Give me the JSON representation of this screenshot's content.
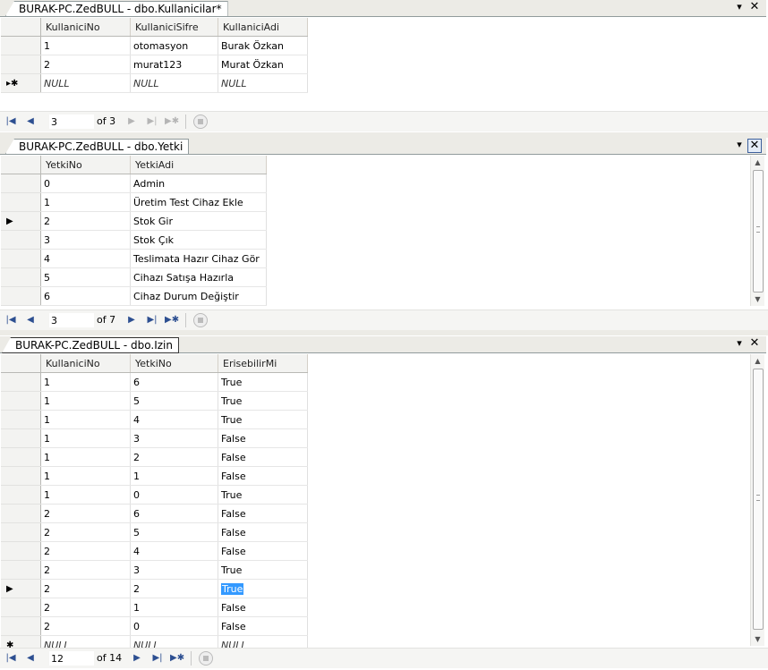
{
  "panes": [
    {
      "tab_title": "BURAK-PC.ZedBULL - dbo.Kullanicilar*",
      "columns": [
        "KullaniciNo",
        "KullaniciSifre",
        "KullaniciAdi"
      ],
      "rows": [
        [
          "1",
          "otomasyon",
          "Burak Özkan"
        ],
        [
          "2",
          "murat123",
          "Murat Özkan"
        ]
      ],
      "new_row": [
        "NULL",
        "NULL",
        "NULL"
      ],
      "new_row_marker": "▸✱",
      "nav": {
        "position": "3",
        "of_label": "of 3"
      }
    },
    {
      "tab_title": "BURAK-PC.ZedBULL - dbo.Yetki",
      "columns": [
        "YetkiNo",
        "YetkiAdi"
      ],
      "rows": [
        [
          "0",
          "Admin"
        ],
        [
          "1",
          "Üretim Test Cihaz Ekle"
        ],
        [
          "2",
          "Stok Gir"
        ],
        [
          "3",
          "Stok Çık"
        ],
        [
          "4",
          "Teslimata Hazır Cihaz Gör"
        ],
        [
          "5",
          "Cihazı Satışa Hazırla"
        ],
        [
          "6",
          "Cihaz Durum Değiştir"
        ]
      ],
      "current_row_index": 2,
      "nav": {
        "position": "3",
        "of_label": "of 7"
      }
    },
    {
      "tab_title": "BURAK-PC.ZedBULL - dbo.Izin",
      "columns": [
        "KullaniciNo",
        "YetkiNo",
        "ErisebilirMi"
      ],
      "rows": [
        [
          "1",
          "6",
          "True"
        ],
        [
          "1",
          "5",
          "True"
        ],
        [
          "1",
          "4",
          "True"
        ],
        [
          "1",
          "3",
          "False"
        ],
        [
          "1",
          "2",
          "False"
        ],
        [
          "1",
          "1",
          "False"
        ],
        [
          "1",
          "0",
          "True"
        ],
        [
          "2",
          "6",
          "False"
        ],
        [
          "2",
          "5",
          "False"
        ],
        [
          "2",
          "4",
          "False"
        ],
        [
          "2",
          "3",
          "True"
        ],
        [
          "2",
          "2",
          "True"
        ],
        [
          "2",
          "1",
          "False"
        ],
        [
          "2",
          "0",
          "False"
        ]
      ],
      "new_row": [
        "NULL",
        "NULL",
        "NULL"
      ],
      "new_row_marker": "✱",
      "current_row_index": 11,
      "selected_cell": "True",
      "nav": {
        "position": "12",
        "of_label": "of 14"
      }
    }
  ],
  "icons": {
    "current_row": "▶",
    "dropdown": "▾",
    "close": "✕",
    "first": "first-record-icon",
    "prev": "previous-record-icon",
    "next": "next-record-icon",
    "last": "last-record-icon",
    "new": "new-record-icon",
    "stop": "stop-icon"
  },
  "colors": {
    "selection": "#3399ff",
    "nav_icon": "#2d4f91"
  }
}
